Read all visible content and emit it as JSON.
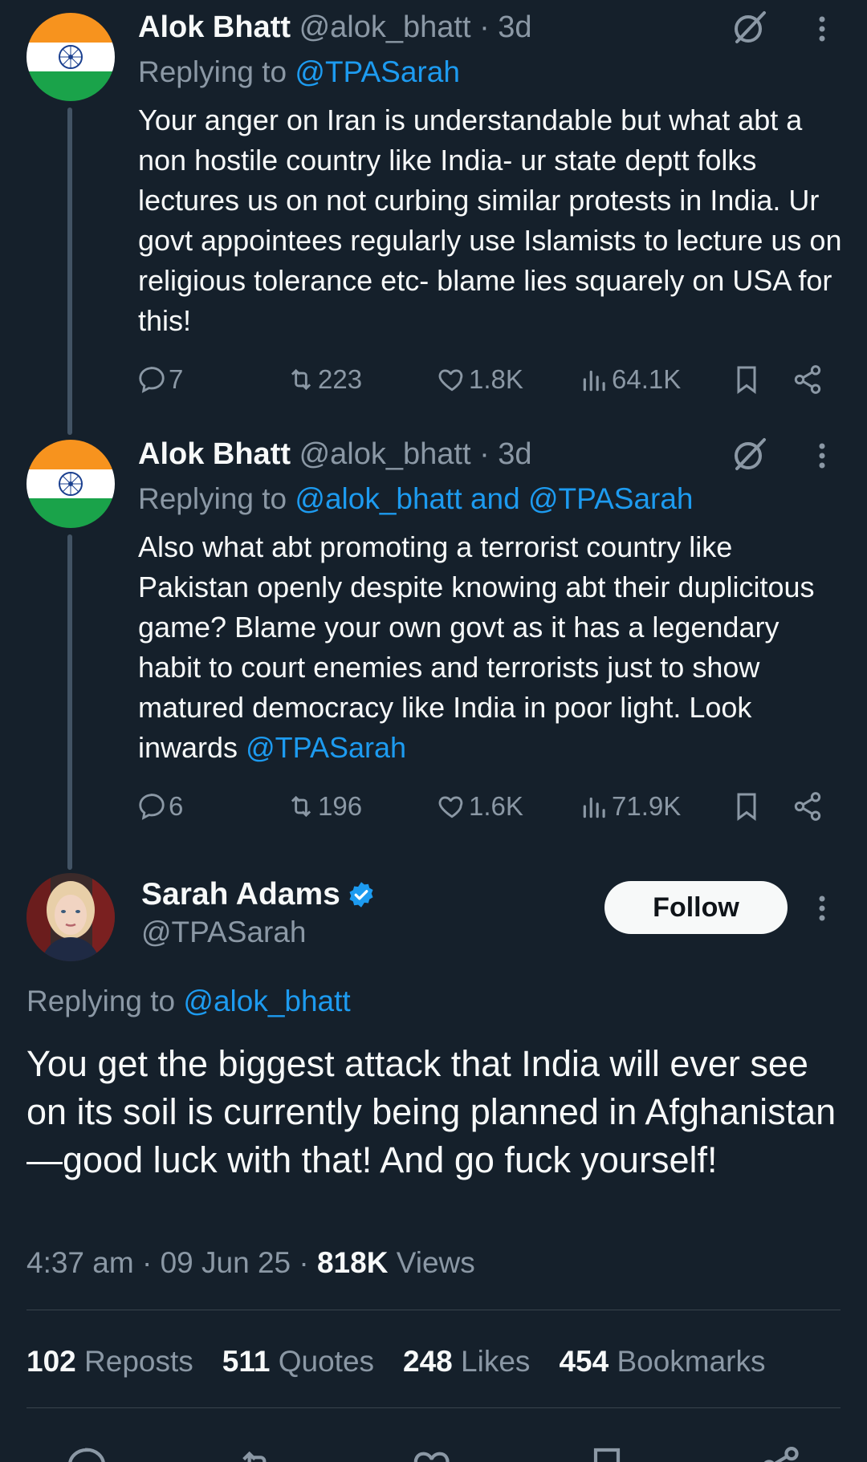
{
  "thread": [
    {
      "author": "Alok Bhatt",
      "handle": "@alok_bhatt",
      "time": "· 3d",
      "replying_prefix": "Replying to",
      "replying_to": "@TPASarah",
      "text": "Your anger on Iran is understandable but what abt a non hostile country like India- ur state deptt folks lectures us on not curbing similar protests in India. Ur govt appointees regularly use Islamists to lecture us on religious tolerance etc- blame lies squarely on USA for this!",
      "text_mention": "",
      "replies": "7",
      "reposts": "223",
      "likes": "1.8K",
      "views": "64.1K"
    },
    {
      "author": "Alok Bhatt",
      "handle": "@alok_bhatt",
      "time": "· 3d",
      "replying_prefix": "Replying to",
      "replying_to": "@alok_bhatt and @TPASarah",
      "text": "Also what abt promoting a terrorist country like Pakistan openly despite knowing abt their duplicitous game? Blame your own govt as it has a legendary habit to court enemies and terrorists just to show matured democracy like India in poor light. Look inwards",
      "text_mention": "@TPASarah",
      "replies": "6",
      "reposts": "196",
      "likes": "1.6K",
      "views": "71.9K"
    }
  ],
  "main": {
    "author": "Sarah Adams",
    "handle": "@TPASarah",
    "follow_label": "Follow",
    "replying_prefix": "Replying to",
    "replying_to": "@alok_bhatt",
    "text": "You get the biggest attack that India will ever see on its soil is currently being planned in Afghanistan—good luck with that! And go fuck yourself!",
    "time": "4:37 am · 09 Jun 25 ·",
    "views_count": "818K",
    "views_label": "Views",
    "stats": {
      "reposts": "102",
      "reposts_label": "Reposts",
      "quotes": "511",
      "quotes_label": "Quotes",
      "likes": "248",
      "likes_label": "Likes",
      "bookmarks": "454",
      "bookmarks_label": "Bookmarks"
    }
  },
  "icons": {
    "reply": "reply-icon",
    "repost": "repost-icon",
    "like": "heart-icon",
    "views": "views-icon",
    "bookmark": "bookmark-icon",
    "share": "share-icon",
    "grok": "grok-icon",
    "more": "more-icon",
    "verified": "verified-badge-icon"
  },
  "colors": {
    "background": "#15202b",
    "accent": "#1d9bf0",
    "muted": "#8b98a5",
    "text": "#f7f9f9"
  }
}
